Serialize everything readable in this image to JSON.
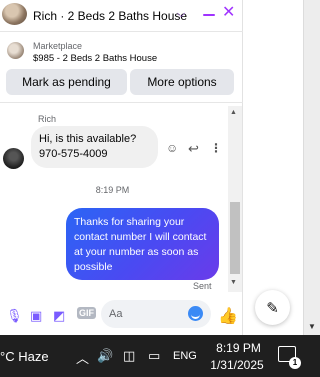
{
  "header": {
    "title": "Rich · 2 Beds 2 Baths House",
    "chevron_icon": "chevron-down-icon",
    "minimize_icon": "minimize-icon",
    "close_icon": "close-icon",
    "accent_color": "#a033ff"
  },
  "listing": {
    "kicker": "Marketplace",
    "subtitle": "$985 - 2 Beds 2 Baths House",
    "buttons": {
      "pending": "Mark as pending",
      "more": "More options"
    }
  },
  "messages": {
    "incoming": {
      "sender": "Rich",
      "line1": "Hi, is this available?",
      "line2": "970-575-4009"
    },
    "timestamp": "8:19 PM",
    "outgoing": {
      "text": "Thanks for sharing your contact number I will contact at your number as soon as possible",
      "gradient": [
        "#2b65f5",
        "#6a3bea"
      ],
      "status": "Sent"
    }
  },
  "composer": {
    "placeholder": "Aa",
    "icons": [
      "microphone-icon",
      "photo-icon",
      "sticker-icon",
      "gif-icon",
      "emoji-icon",
      "thumbs-up-icon"
    ]
  },
  "taskbar": {
    "weather": "°C  Haze",
    "language": "ENG",
    "time": "8:19 PM",
    "date": "1/31/2025",
    "notification_count": "1"
  }
}
